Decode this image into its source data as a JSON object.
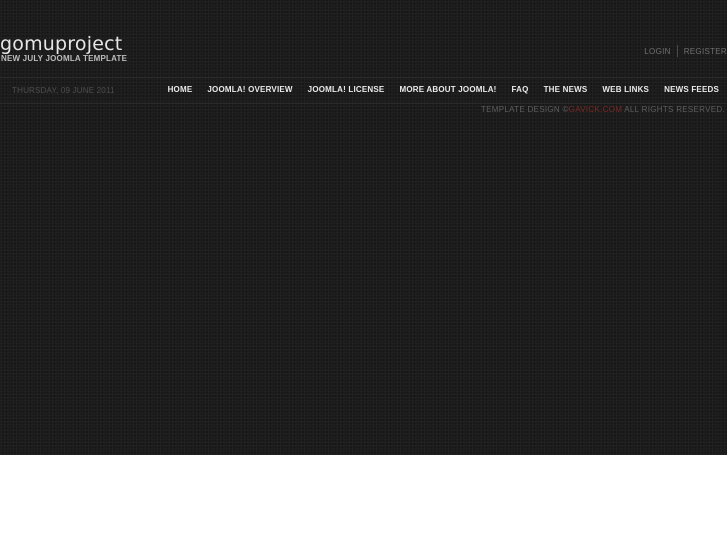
{
  "header": {
    "logo_text": "GOMUPROJECT",
    "tagline": "NEW JULY JOOMLA TEMPLATE"
  },
  "userlinks": {
    "login": "LOGIN",
    "register": "REGISTER"
  },
  "navbar": {
    "date": "THURSDAY, 09 JUNE 2011",
    "menu": [
      "HOME",
      "JOOMLA! OVERVIEW",
      "JOOMLA! LICENSE",
      "MORE ABOUT JOOMLA!",
      "FAQ",
      "THE NEWS",
      "WEB LINKS",
      "NEWS FEEDS"
    ]
  },
  "footer": {
    "prefix": "TEMPLATE DESIGN ©",
    "brand": "GAVICK.COM",
    "suffix": "ALL RIGHTS RESERVED."
  },
  "colors": {
    "background": "#1b1b1b",
    "brand_accent": "#7a2a24"
  }
}
